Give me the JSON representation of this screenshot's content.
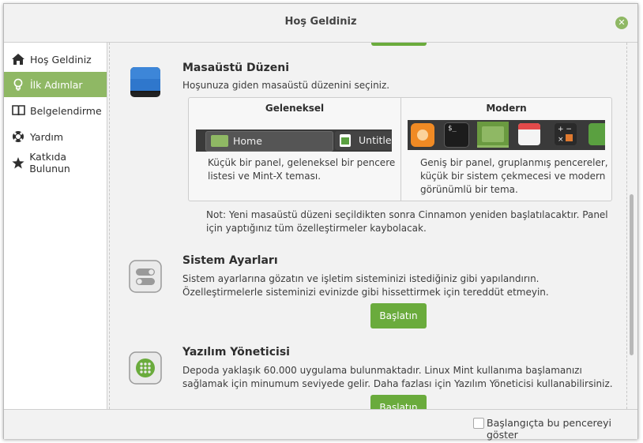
{
  "window": {
    "title": "Hoş Geldiniz"
  },
  "sidebar": {
    "items": [
      {
        "label": "Hoş Geldiniz",
        "icon": "home-icon"
      },
      {
        "label": "İlk Adımlar",
        "icon": "lightbulb-icon"
      },
      {
        "label": "Belgelendirme",
        "icon": "book-icon"
      },
      {
        "label": "Yardım",
        "icon": "lifebuoy-icon"
      },
      {
        "label": "Katkıda Bulunun",
        "icon": "star-icon"
      }
    ],
    "active_index": 1
  },
  "desktop_layout": {
    "title": "Masaüstü Düzeni",
    "description": "Hoşunuza giden masaüstü düzenini seçiniz.",
    "traditional": {
      "title": "Geleneksel",
      "preview_tab_1": "Home",
      "preview_tab_2": "Untitle",
      "description": "Küçük bir panel, geleneksel bir pencere listesi ve Mint-X teması."
    },
    "modern": {
      "title": "Modern",
      "description": "Geniş bir panel, gruplanmış pencereler, küçük bir sistem çekmecesi ve modern görünümlü bir tema."
    },
    "note": "Not: Yeni masaüstü düzeni seçildikten sonra Cinnamon yeniden başlatılacaktır. Panel için yaptığınız tüm özelleştirmeler kaybolacak."
  },
  "system_settings": {
    "title": "Sistem Ayarları",
    "description": "Sistem ayarlarına gözatın ve işletim sisteminizi istediğiniz gibi yapılandırın. Özelleştirmelerle sisteminizi evinizde gibi hissettirmek için tereddüt etmeyin.",
    "button_label": "Başlatın"
  },
  "software_manager": {
    "title": "Yazılım Yöneticisi",
    "description": "Depoda yaklaşık 60.000 uygulama bulunmaktadır. Linux Mint kullanıma başlamanızı sağlamak için minumum seviyede gelir. Daha fazlası için Yazılım Yöneticisi kullanabilirsiniz.",
    "button_label": "Başlatın"
  },
  "footer": {
    "show_on_startup_label": "Başlangıçta bu pencereyi göster",
    "show_on_startup_checked": false
  },
  "colors": {
    "accent": "#8fb864",
    "button": "#6aab3c",
    "panel_dark": "#3a3a3a"
  }
}
